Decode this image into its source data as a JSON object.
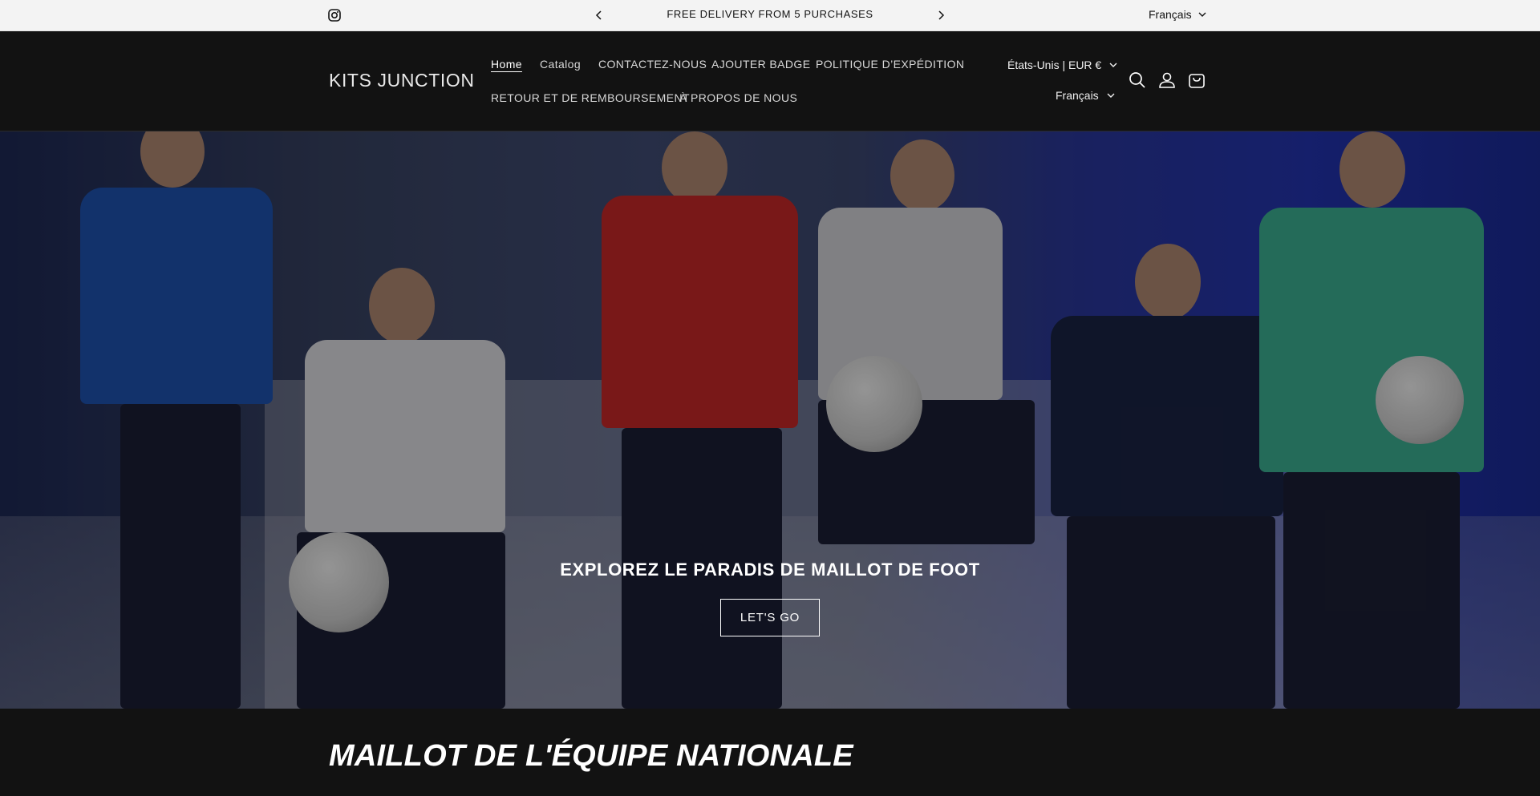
{
  "announcement": {
    "message": "FREE DELIVERY FROM 5 PURCHASES",
    "language": "Français"
  },
  "header": {
    "logo": "KITS JUNCTION",
    "nav": [
      {
        "label": "Home",
        "active": true
      },
      {
        "label": "Catalog"
      },
      {
        "label": "CONTACTEZ-NOUS"
      },
      {
        "label": "AJOUTER BADGE"
      },
      {
        "label": "POLITIQUE D’EXPÉDITION"
      },
      {
        "label": "RETOUR ET DE REMBOURSEMENT"
      },
      {
        "label": "À PROPOS DE NOUS"
      }
    ],
    "country_currency": "États-Unis | EUR €",
    "language": "Français",
    "icons": [
      "search-icon",
      "account-icon",
      "cart-icon"
    ]
  },
  "hero": {
    "title": "EXPLOREZ LE PARADIS DE MAILLOT DE FOOT",
    "button": "LET'S GO"
  },
  "section": {
    "title": "MAILLOT DE L'ÉQUIPE NATIONALE"
  }
}
